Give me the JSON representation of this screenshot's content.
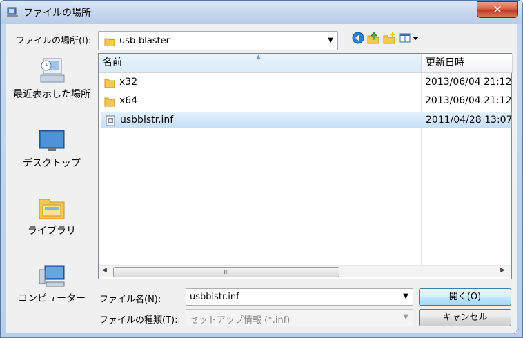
{
  "window": {
    "title": "ファイルの場所",
    "close_label": "✕"
  },
  "lookin": {
    "label": "ファイルの場所(I):",
    "value": "usb-blaster"
  },
  "toolbar": {
    "back_icon": "back-icon",
    "up_icon": "up-folder-icon",
    "new_folder_icon": "new-folder-icon",
    "view_icon": "view-menu-icon"
  },
  "places": [
    {
      "label": "最近表示した場所",
      "icon": "recent-places-icon"
    },
    {
      "label": "デスクトップ",
      "icon": "desktop-icon"
    },
    {
      "label": "ライブラリ",
      "icon": "libraries-icon"
    },
    {
      "label": "コンピューター",
      "icon": "computer-icon"
    }
  ],
  "list": {
    "col_name": "名前",
    "col_date": "更新日時",
    "rows": [
      {
        "name": "x32",
        "date": "2013/06/04 21:12",
        "type": "folder"
      },
      {
        "name": "x64",
        "date": "2013/06/04 21:12",
        "type": "folder"
      },
      {
        "name": "usbblstr.inf",
        "date": "2011/04/28 13:07",
        "type": "file",
        "selected": true
      }
    ],
    "scroll_grip": "III"
  },
  "filename": {
    "label": "ファイル名(N):",
    "value": "usbblstr.inf"
  },
  "filetype": {
    "label": "ファイルの種類(T):",
    "value": "セットアップ情報 (*.inf)"
  },
  "buttons": {
    "open": "開く(O)",
    "cancel": "キャンセル"
  },
  "colors": {
    "accent": "#3c7fb1",
    "selection": "#c4dff7",
    "close": "#c23b20"
  }
}
